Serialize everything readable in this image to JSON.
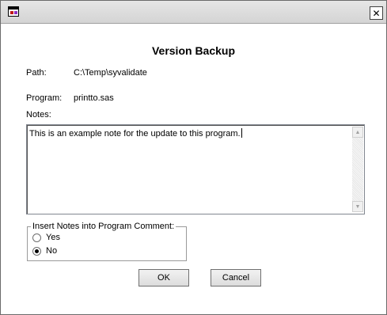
{
  "window": {
    "close_glyph": "✕"
  },
  "dialog": {
    "title": "Version Backup"
  },
  "fields": {
    "path_label": "Path:",
    "path_value": "C:\\Temp\\syvalidate",
    "program_label": "Program:",
    "program_value": "printto.sas",
    "notes_label": "Notes:",
    "notes_value": "This is an example note for the update to this program."
  },
  "insert_group": {
    "legend": "Insert Notes into Program Comment:",
    "options": [
      {
        "label": "Yes",
        "selected": false
      },
      {
        "label": "No",
        "selected": true
      }
    ]
  },
  "buttons": {
    "ok": "OK",
    "cancel": "Cancel"
  },
  "icons": {
    "app": "app-window-icon",
    "close": "close-icon"
  }
}
